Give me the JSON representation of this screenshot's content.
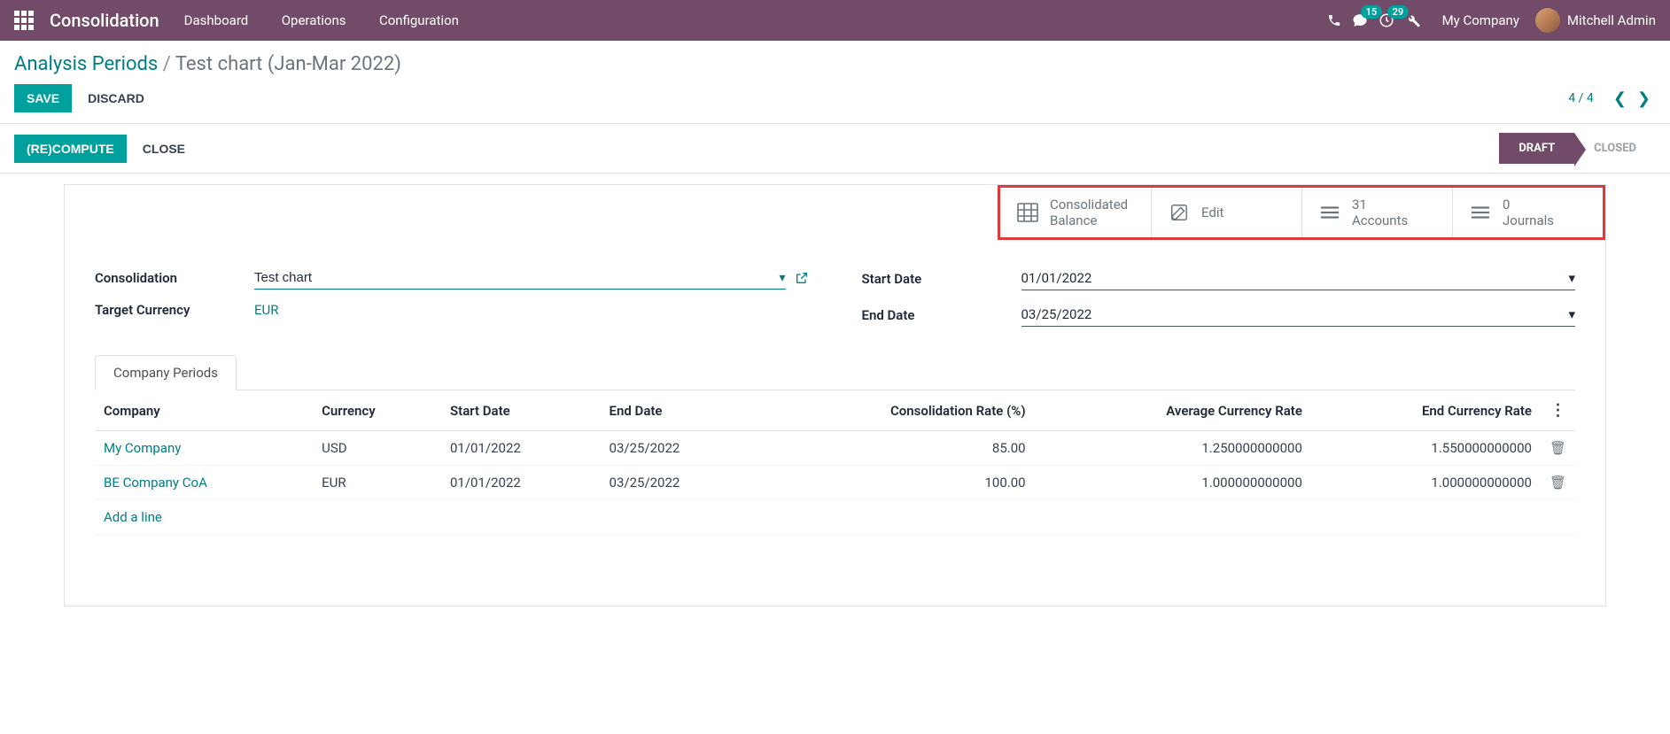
{
  "nav": {
    "brand": "Consolidation",
    "menu": [
      "Dashboard",
      "Operations",
      "Configuration"
    ],
    "messages_badge": "15",
    "activities_badge": "29",
    "company": "My Company",
    "user": "Mitchell Admin"
  },
  "breadcrumb": {
    "parent": "Analysis Periods",
    "sep": " / ",
    "current": "Test chart (Jan-Mar 2022)"
  },
  "actions": {
    "save": "SAVE",
    "discard": "DISCARD",
    "pager": "4 / 4"
  },
  "statusbar": {
    "recompute": "(RE)COMPUTE",
    "close": "CLOSE",
    "states": {
      "draft": "DRAFT",
      "closed": "CLOSED"
    }
  },
  "stat_buttons": {
    "consolidated_l1": "Consolidated",
    "consolidated_l2": "Balance",
    "edit": "Edit",
    "accounts_n": "31",
    "accounts_l": "Accounts",
    "journals_n": "0",
    "journals_l": "Journals"
  },
  "form": {
    "consolidation_label": "Consolidation",
    "consolidation_value": "Test chart",
    "target_currency_label": "Target Currency",
    "target_currency_value": "EUR",
    "start_date_label": "Start Date",
    "start_date_value": "01/01/2022",
    "end_date_label": "End Date",
    "end_date_value": "03/25/2022"
  },
  "tabs": {
    "company_periods": "Company Periods"
  },
  "table": {
    "headers": {
      "company": "Company",
      "currency": "Currency",
      "start": "Start Date",
      "end": "End Date",
      "rate": "Consolidation Rate (%)",
      "avg": "Average Currency Rate",
      "endc": "End Currency Rate"
    },
    "rows": [
      {
        "company": "My Company",
        "currency": "USD",
        "start": "01/01/2022",
        "end": "03/25/2022",
        "rate": "85.00",
        "avg": "1.250000000000",
        "endc": "1.550000000000"
      },
      {
        "company": "BE Company CoA",
        "currency": "EUR",
        "start": "01/01/2022",
        "end": "03/25/2022",
        "rate": "100.00",
        "avg": "1.000000000000",
        "endc": "1.000000000000"
      }
    ],
    "add_line": "Add a line"
  }
}
